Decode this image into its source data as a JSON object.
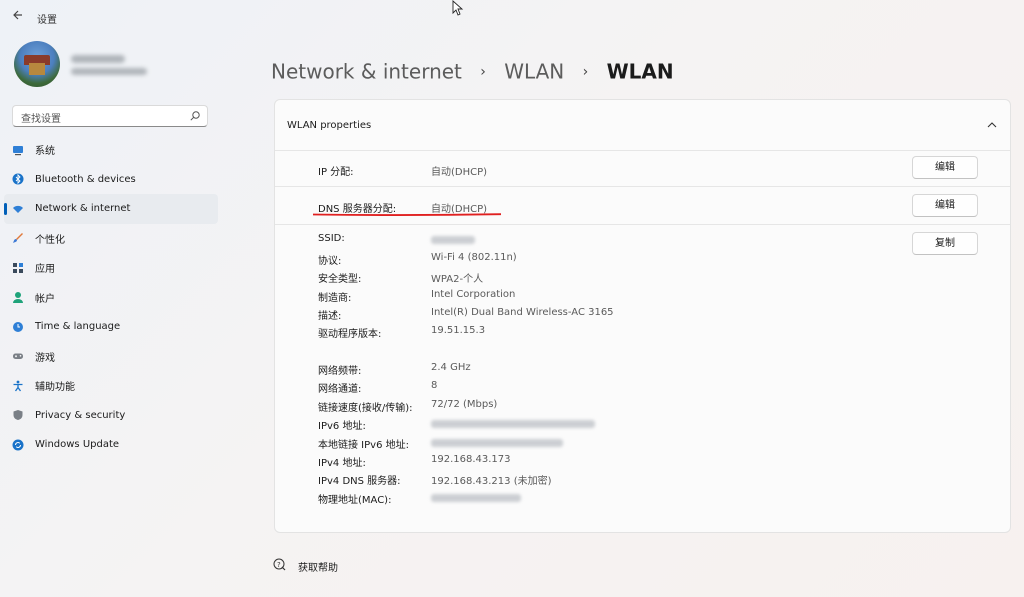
{
  "window": {
    "title": "设置",
    "back_icon": "back-arrow-icon"
  },
  "search": {
    "placeholder": "查找设置",
    "icon": "search-icon"
  },
  "sidebar": {
    "items": [
      {
        "label": "系统",
        "icon": "system-icon",
        "active": false
      },
      {
        "label": "Bluetooth & devices",
        "icon": "bluetooth-icon",
        "active": false
      },
      {
        "label": "Network & internet",
        "icon": "wifi-icon",
        "active": true
      },
      {
        "label": "个性化",
        "icon": "brush-icon",
        "active": false
      },
      {
        "label": "应用",
        "icon": "apps-icon",
        "active": false
      },
      {
        "label": "帐户",
        "icon": "account-icon",
        "active": false
      },
      {
        "label": "Time & language",
        "icon": "globe-clock-icon",
        "active": false
      },
      {
        "label": "游戏",
        "icon": "gamepad-icon",
        "active": false
      },
      {
        "label": "辅助功能",
        "icon": "accessibility-icon",
        "active": false
      },
      {
        "label": "Privacy & security",
        "icon": "shield-icon",
        "active": false
      },
      {
        "label": "Windows Update",
        "icon": "update-icon",
        "active": false
      }
    ]
  },
  "breadcrumb": {
    "items": [
      "Network & internet",
      "WLAN"
    ],
    "current": "WLAN"
  },
  "card": {
    "title": "WLAN properties",
    "ip_assign": {
      "label": "IP 分配:",
      "value": "自动(DHCP)",
      "button": "编辑"
    },
    "dns_assign": {
      "label": "DNS 服务器分配:",
      "value": "自动(DHCP)",
      "button": "编辑"
    },
    "copy_button": "复制",
    "properties": [
      {
        "label": "SSID:",
        "value": ""
      },
      {
        "label": "协议:",
        "value": "Wi-Fi 4 (802.11n)"
      },
      {
        "label": "安全类型:",
        "value": "WPA2-个人"
      },
      {
        "label": "制造商:",
        "value": "Intel Corporation"
      },
      {
        "label": "描述:",
        "value": "Intel(R) Dual Band Wireless-AC 3165"
      },
      {
        "label": "驱动程序版本:",
        "value": "19.51.15.3"
      },
      {
        "label": "网络频带:",
        "value": "2.4 GHz"
      },
      {
        "label": "网络通道:",
        "value": "8"
      },
      {
        "label": "链接速度(接收/传输):",
        "value": "72/72 (Mbps)"
      },
      {
        "label": "IPv6 地址:",
        "value": ""
      },
      {
        "label": "本地链接 IPv6 地址:",
        "value": ""
      },
      {
        "label": "IPv4 地址:",
        "value": "192.168.43.173"
      },
      {
        "label": "IPv4 DNS 服务器:",
        "value": "192.168.43.213 (未加密)"
      },
      {
        "label": "物理地址(MAC):",
        "value": ""
      }
    ]
  },
  "help": {
    "label": "获取帮助",
    "icon": "help-icon"
  },
  "colors": {
    "accent": "#005fb8",
    "annotation_red": "#e02020"
  }
}
